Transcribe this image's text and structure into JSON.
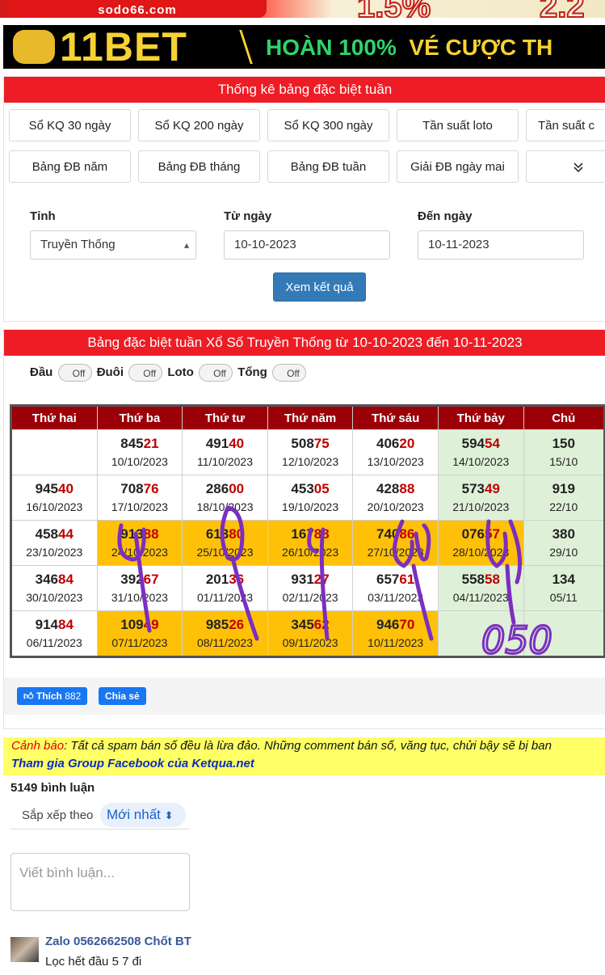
{
  "banner_top": {
    "brand": "sodo66.com",
    "offer_left": "1.5%",
    "offer_right": "2.2"
  },
  "banner_ad": {
    "brand": "11BET",
    "promo_highlight": "HOÀN 100%",
    "promo_text": "VÉ CƯỢC TH"
  },
  "filter_panel": {
    "title": "Thống kê bảng đặc biệt tuần",
    "nav_row1": [
      "Sổ KQ 30 ngày",
      "Sổ KQ 200 ngày",
      "Sổ KQ 300 ngày",
      "Tần suất loto",
      "Tần suất c"
    ],
    "nav_row2": [
      "Bảng ĐB năm",
      "Bảng ĐB tháng",
      "Bảng ĐB tuần",
      "Giải ĐB ngày mai"
    ],
    "more_icon": "chevron-double-down-icon",
    "province_label": "Tỉnh",
    "province_value": "Truyền Thống",
    "from_label": "Từ ngày",
    "from_value": "10-10-2023",
    "to_label": "Đến ngày",
    "to_value": "10-11-2023",
    "submit_label": "Xem kết quả"
  },
  "results_panel": {
    "title": "Bảng đặc biệt tuần Xổ Số Truyền Thống từ 10-10-2023 đến 10-11-2023",
    "toggles": [
      {
        "label": "Đầu",
        "state": "Off"
      },
      {
        "label": "Đuôi",
        "state": "Off"
      },
      {
        "label": "Loto",
        "state": "Off"
      },
      {
        "label": "Tổng",
        "state": "Off"
      }
    ],
    "headers": [
      "Thứ hai",
      "Thứ ba",
      "Thứ tư",
      "Thứ năm",
      "Thứ sáu",
      "Thứ bảy",
      "Chủ"
    ],
    "rows": [
      [
        {
          "head": "",
          "tail": "",
          "date": ""
        },
        {
          "head": "845",
          "tail": "21",
          "date": "10/10/2023"
        },
        {
          "head": "491",
          "tail": "40",
          "date": "11/10/2023"
        },
        {
          "head": "508",
          "tail": "75",
          "date": "12/10/2023"
        },
        {
          "head": "406",
          "tail": "20",
          "date": "13/10/2023"
        },
        {
          "head": "594",
          "tail": "54",
          "date": "14/10/2023"
        },
        {
          "head": "150",
          "tail": "",
          "date": "15/10"
        }
      ],
      [
        {
          "head": "945",
          "tail": "40",
          "date": "16/10/2023"
        },
        {
          "head": "708",
          "tail": "76",
          "date": "17/10/2023"
        },
        {
          "head": "286",
          "tail": "00",
          "date": "18/10/2023"
        },
        {
          "head": "453",
          "tail": "05",
          "date": "19/10/2023"
        },
        {
          "head": "428",
          "tail": "88",
          "date": "20/10/2023"
        },
        {
          "head": "573",
          "tail": "49",
          "date": "21/10/2023"
        },
        {
          "head": "919",
          "tail": "",
          "date": "22/10"
        }
      ],
      [
        {
          "head": "458",
          "tail": "44",
          "date": "23/10/2023"
        },
        {
          "head": "913",
          "tail": "88",
          "date": "24/10/2023"
        },
        {
          "head": "613",
          "tail": "80",
          "date": "25/10/2023"
        },
        {
          "head": "167",
          "tail": "88",
          "date": "26/10/2023"
        },
        {
          "head": "740",
          "tail": "86",
          "date": "27/10/2023"
        },
        {
          "head": "076",
          "tail": "57",
          "date": "28/10/2023"
        },
        {
          "head": "380",
          "tail": "",
          "date": "29/10"
        }
      ],
      [
        {
          "head": "346",
          "tail": "84",
          "date": "30/10/2023"
        },
        {
          "head": "392",
          "tail": "67",
          "date": "31/10/2023"
        },
        {
          "head": "201",
          "tail": "36",
          "date": "01/11/2023"
        },
        {
          "head": "931",
          "tail": "27",
          "date": "02/11/2023"
        },
        {
          "head": "657",
          "tail": "61",
          "date": "03/11/2023"
        },
        {
          "head": "558",
          "tail": "58",
          "date": "04/11/2023"
        },
        {
          "head": "134",
          "tail": "",
          "date": "05/11"
        }
      ],
      [
        {
          "head": "914",
          "tail": "84",
          "date": "06/11/2023"
        },
        {
          "head": "109",
          "tail": "49",
          "date": "07/11/2023"
        },
        {
          "head": "985",
          "tail": "26",
          "date": "08/11/2023"
        },
        {
          "head": "345",
          "tail": "62",
          "date": "09/11/2023"
        },
        {
          "head": "946",
          "tail": "70",
          "date": "10/11/2023"
        },
        {
          "head": "",
          "tail": "",
          "date": ""
        },
        {
          "head": "",
          "tail": "",
          "date": ""
        }
      ]
    ],
    "highlight": [
      [
        2,
        1
      ],
      [
        2,
        2
      ],
      [
        2,
        3
      ],
      [
        2,
        4
      ],
      [
        2,
        5
      ],
      [
        4,
        1
      ],
      [
        4,
        2
      ],
      [
        4,
        3
      ],
      [
        4,
        4
      ]
    ],
    "handwritten_note": "050",
    "like_label": "Thích",
    "like_count": "882",
    "share_label": "Chia sẻ"
  },
  "comments": {
    "warning_prefix": "Cảnh báo",
    "warning_text": ": Tất cả spam bán số đều là lừa đảo. Những comment bán số, văng tục, chửi bậy sẽ bị ban",
    "group_link": "Tham gia Group Facebook của Ketqua.net",
    "count_text": "5149 bình luận",
    "sort_label": "Sắp xếp theo",
    "sort_value": "Mới nhất",
    "input_placeholder": "Viết bình luận...",
    "first_comment": {
      "author": "Zalo 0562662508 Chốt BT",
      "text": "Lọc hết đầu 5 7 đi"
    }
  },
  "colors": {
    "red_header": "#ee1c25",
    "table_header": "#9b0008",
    "highlight": "#ffc107",
    "saturday": "#dff0d8",
    "button_blue": "#337ab7",
    "ink": "#7b2fbf"
  }
}
